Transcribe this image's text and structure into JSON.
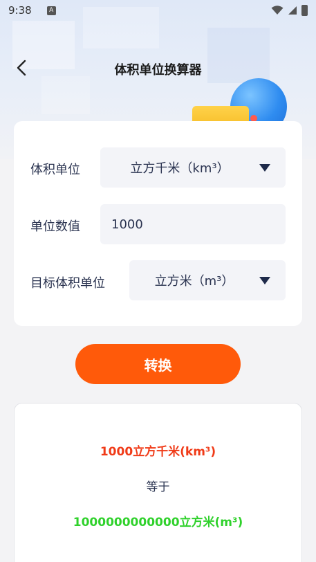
{
  "status_bar": {
    "time": "9:38",
    "notification_glyph": "A"
  },
  "colors": {
    "primary_button": "#ff5a0a",
    "source_text": "#f03a17",
    "target_text": "#2fd12b",
    "label_text": "#2a3350"
  },
  "header": {
    "title": "体积单位换算器",
    "back_icon": "chevron-left-icon"
  },
  "form": {
    "volume_unit": {
      "label": "体积单位",
      "value": "立方千米（km³）"
    },
    "unit_value": {
      "label": "单位数值",
      "value": "1000"
    },
    "target_unit": {
      "label": "目标体积单位",
      "value": "立方米（m³）"
    }
  },
  "convert_button": {
    "label": "转换"
  },
  "result": {
    "source": "1000立方千米(km³)",
    "equals": "等于",
    "target": "1000000000000立方米(m³)"
  }
}
